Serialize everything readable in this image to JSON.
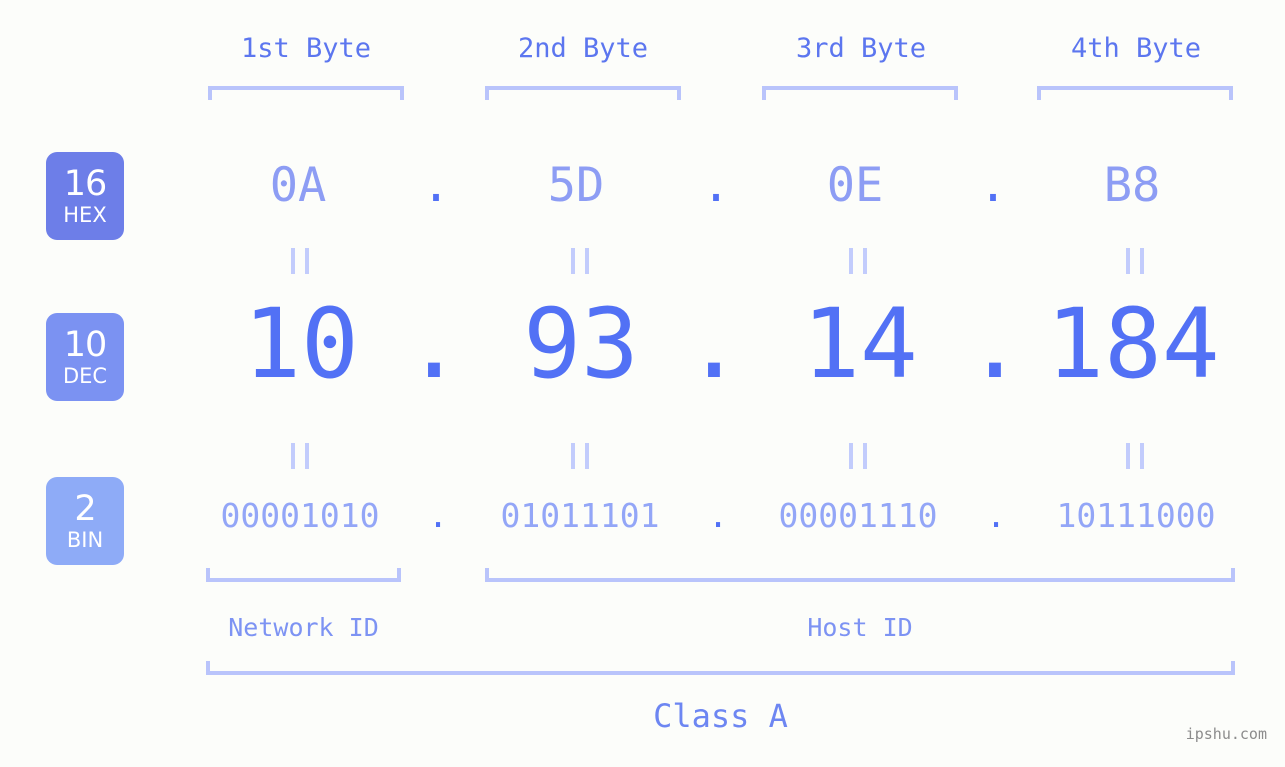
{
  "ip": {
    "address": "10.93.14.184",
    "class": "Class A"
  },
  "headers": {
    "byte1": "1st Byte",
    "byte2": "2nd Byte",
    "byte3": "3rd Byte",
    "byte4": "4th Byte"
  },
  "bases": [
    {
      "num": "16",
      "sub": "HEX",
      "color": "#6d7ee8"
    },
    {
      "num": "10",
      "sub": "DEC",
      "color": "#7b92f2"
    },
    {
      "num": "2",
      "sub": "BIN",
      "color": "#8eabf7"
    }
  ],
  "rows": {
    "hex": {
      "label": "HEX",
      "octets": [
        "0A",
        "5D",
        "0E",
        "B8"
      ],
      "separator": "."
    },
    "dec": {
      "label": "DEC",
      "octets": [
        "10",
        "93",
        "14",
        "184"
      ],
      "separator": "."
    },
    "bin": {
      "label": "BIN",
      "octets": [
        "00001010",
        "01011101",
        "00001110",
        "10111000"
      ],
      "separator": "."
    }
  },
  "equality": {
    "symbol": "="
  },
  "segments": {
    "network_id": "Network ID",
    "host_id": "Host ID",
    "class_label": "Class A"
  },
  "watermark": "ipshu.com",
  "colors": {
    "background": "#fcfdfa",
    "accent_strong": "#5271f5",
    "accent_mid": "#8d9df4",
    "accent_light": "#b9c4fb",
    "header_text": "#5c76ef",
    "watermark_gray": "#8c8c8c"
  },
  "chart_data": {
    "type": "table",
    "title": "IPv4 Address 10.93.14.184 base conversion",
    "columns": [
      "1st Byte",
      "2nd Byte",
      "3rd Byte",
      "4th Byte"
    ],
    "rows": [
      {
        "base": 16,
        "name": "HEX",
        "values": [
          "0A",
          "5D",
          "0E",
          "B8"
        ]
      },
      {
        "base": 10,
        "name": "DEC",
        "values": [
          "10",
          "93",
          "14",
          "184"
        ]
      },
      {
        "base": 2,
        "name": "BIN",
        "values": [
          "00001010",
          "01011101",
          "00001110",
          "10111000"
        ]
      }
    ],
    "annotations": [
      {
        "label": "Network ID",
        "bytes": [
          1
        ]
      },
      {
        "label": "Host ID",
        "bytes": [
          2,
          3,
          4
        ]
      },
      {
        "label": "Class A",
        "bytes": [
          1,
          2,
          3,
          4
        ]
      }
    ]
  }
}
